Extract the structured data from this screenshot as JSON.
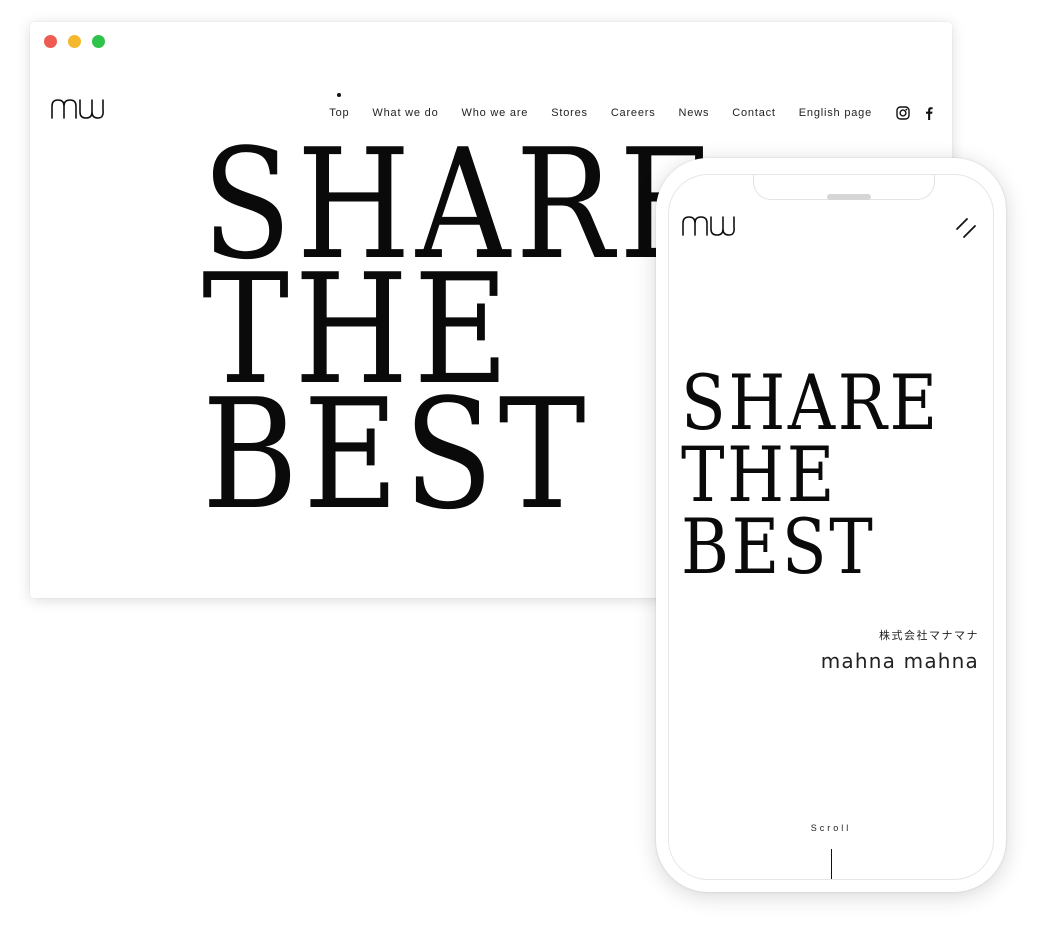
{
  "colors": {
    "dot_red": "#ee5b52",
    "dot_yellow": "#f5b82c",
    "dot_green": "#2fc34a",
    "text": "#0a0a0a"
  },
  "desktop": {
    "nav": [
      "Top",
      "What we do",
      "Who we are",
      "Stores",
      "Careers",
      "News",
      "Contact",
      "English page"
    ],
    "active_nav": "Top",
    "social_icons": [
      "instagram-icon",
      "facebook-icon"
    ],
    "hero": [
      "SHARE",
      "THE",
      "BEST"
    ]
  },
  "mobile": {
    "hero": [
      "SHARE",
      "THE",
      "BEST"
    ],
    "company_jp": "株式会社マナマナ",
    "company_en": "mahna mahna",
    "scroll": "Scroll",
    "menu_icon": "menu-icon"
  }
}
